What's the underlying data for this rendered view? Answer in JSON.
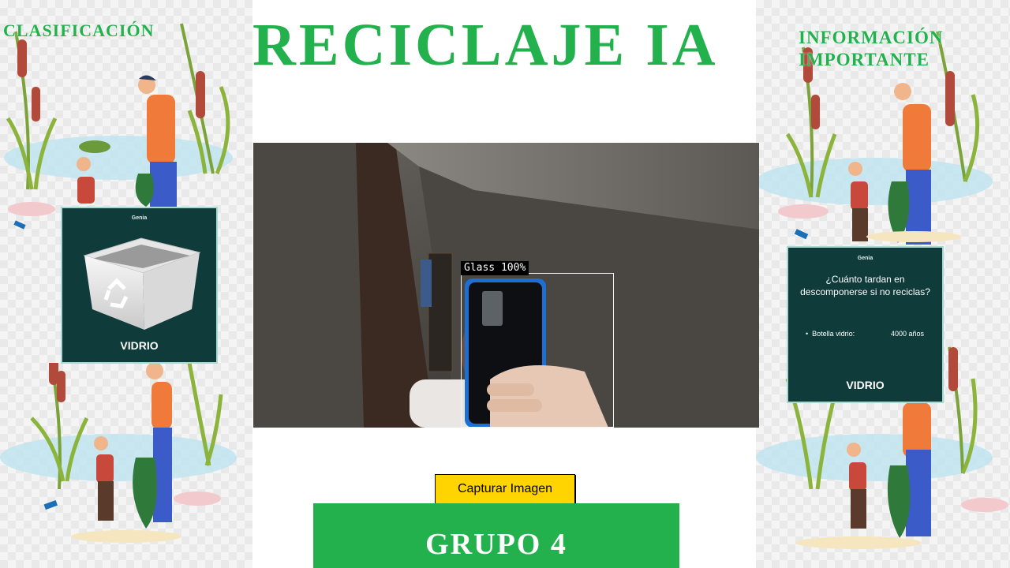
{
  "title": "RECICLAJE IA",
  "left_panel": {
    "heading": "CLASIFICACIÓN",
    "card": {
      "brand": "Genia",
      "label": "VIDRIO",
      "icon": "recycle-bin-icon"
    }
  },
  "right_panel": {
    "heading_line1": "INFORMACIÓN",
    "heading_line2": "IMPORTANTE",
    "card": {
      "brand": "Genia",
      "question": "¿Cuánto tardan en descomponerse si no reciclas?",
      "item_label": "Botella vidrio:",
      "item_value": "4000 años",
      "label": "VIDRIO"
    }
  },
  "camera": {
    "detection_label": "Glass",
    "confidence": "100%"
  },
  "capture_button": "Capturar Imagen",
  "group_banner": "GRUPO 4",
  "colors": {
    "brand_green": "#22b14c",
    "card_bg": "#0f3b3b",
    "button_yellow": "#ffd400"
  }
}
